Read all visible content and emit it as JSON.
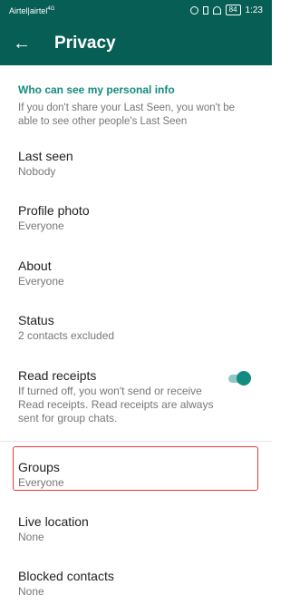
{
  "status_bar": {
    "carrier": "Airtel|airtel",
    "network_tag": "4G",
    "battery": "84",
    "time": "1:23"
  },
  "app_bar": {
    "title": "Privacy"
  },
  "section": {
    "header": "Who can see my personal info",
    "description": "If you don't share your Last Seen, you won't be able to see other people's Last Seen"
  },
  "rows": {
    "last_seen": {
      "label": "Last seen",
      "value": "Nobody"
    },
    "profile_photo": {
      "label": "Profile photo",
      "value": "Everyone"
    },
    "about": {
      "label": "About",
      "value": "Everyone"
    },
    "status": {
      "label": "Status",
      "value": "2 contacts excluded"
    },
    "read_receipts": {
      "label": "Read receipts",
      "description": "If turned off, you won't send or receive Read receipts. Read receipts are always sent for group chats.",
      "enabled": true
    },
    "groups": {
      "label": "Groups",
      "value": "Everyone"
    },
    "live_location": {
      "label": "Live location",
      "value": "None"
    },
    "blocked_contacts": {
      "label": "Blocked contacts",
      "value": "None"
    }
  },
  "colors": {
    "primary": "#075e54",
    "accent": "#128c7e",
    "highlight": "#e53935"
  },
  "icons": {
    "back": "back-arrow-icon",
    "toggle": "toggle-switch"
  }
}
